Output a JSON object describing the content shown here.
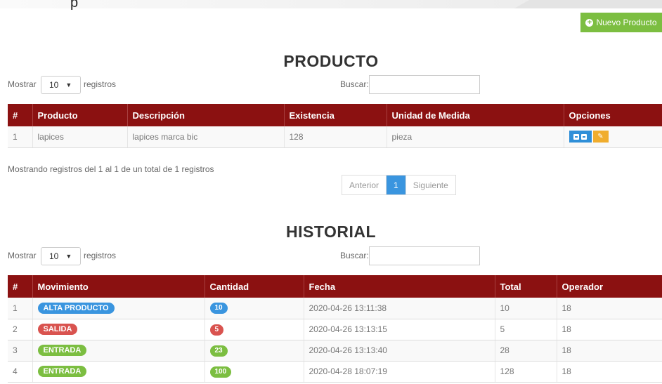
{
  "header": {
    "partial_char": "p",
    "new_button_label": "Nuevo Producto"
  },
  "colors": {
    "header_red": "#8b1111",
    "green": "#7cbe41",
    "blue": "#3a95df",
    "red": "#d9534f",
    "yellow": "#f0ad2e"
  },
  "producto": {
    "title": "PRODUCTO",
    "length": {
      "prefix": "Mostrar",
      "value": "10",
      "suffix": "registros"
    },
    "search": {
      "label": "Buscar:",
      "value": ""
    },
    "columns": [
      "#",
      "Producto",
      "Descripción",
      "Existencia",
      "Unidad de Medida",
      "Opciones"
    ],
    "rows": [
      {
        "num": "1",
        "producto": "lapices",
        "descripcion": "lapices marca bic",
        "existencia": "128",
        "unidad": "pieza"
      }
    ],
    "info": "Mostrando registros del 1 al 1 de un total de 1 registros",
    "pagination": {
      "prev": "Anterior",
      "current": "1",
      "next": "Siguiente"
    }
  },
  "historial": {
    "title": "HISTORIAL",
    "length": {
      "prefix": "Mostrar",
      "value": "10",
      "suffix": "registros"
    },
    "search": {
      "label": "Buscar:",
      "value": ""
    },
    "columns": [
      "#",
      "Movimiento",
      "Cantidad",
      "Fecha",
      "Total",
      "Operador"
    ],
    "rows": [
      {
        "num": "1",
        "movimiento": "ALTA PRODUCTO",
        "mov_color": "#3a95df",
        "cantidad": "10",
        "cant_color": "#3a95df",
        "fecha": "2020-04-26 13:11:38",
        "total": "10",
        "operador": "18"
      },
      {
        "num": "2",
        "movimiento": "SALIDA",
        "mov_color": "#d9534f",
        "cantidad": "5",
        "cant_color": "#d9534f",
        "fecha": "2020-04-26 13:13:15",
        "total": "5",
        "operador": "18"
      },
      {
        "num": "3",
        "movimiento": "ENTRADA",
        "mov_color": "#7cbe41",
        "cantidad": "23",
        "cant_color": "#7cbe41",
        "fecha": "2020-04-26 13:13:40",
        "total": "28",
        "operador": "18"
      },
      {
        "num": "4",
        "movimiento": "ENTRADA",
        "mov_color": "#7cbe41",
        "cantidad": "100",
        "cant_color": "#7cbe41",
        "fecha": "2020-04-28 18:07:19",
        "total": "128",
        "operador": "18"
      }
    ]
  }
}
